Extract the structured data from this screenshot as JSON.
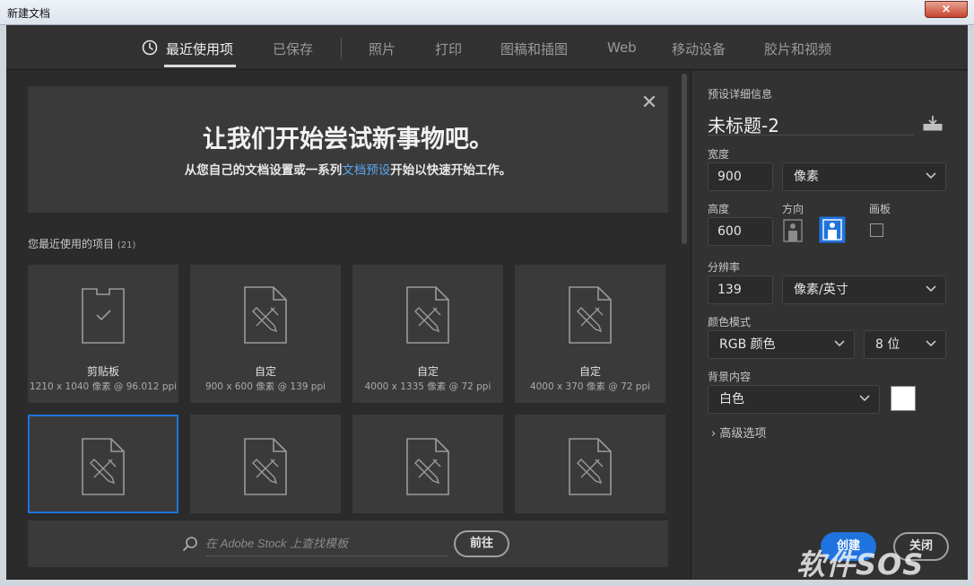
{
  "window": {
    "title": "新建文档",
    "close_glyph": "×"
  },
  "tabs": [
    {
      "label": "最近使用项",
      "active": true,
      "icon": "clock-icon"
    },
    {
      "label": "已保存"
    },
    {
      "label": "照片"
    },
    {
      "label": "打印"
    },
    {
      "label": "图稿和插图"
    },
    {
      "label": "Web"
    },
    {
      "label": "移动设备"
    },
    {
      "label": "胶片和视频"
    }
  ],
  "welcome": {
    "title": "让我们开始尝试新事物吧。",
    "sub_before": "从您自己的文档设置或一系列",
    "sub_link": "文档预设",
    "sub_after": "开始以快速开始工作。",
    "close_glyph": "✕"
  },
  "recent": {
    "label": "您最近使用的项目",
    "count": "(21)",
    "items": [
      {
        "name": "剪贴板",
        "meta": "1210 x 1040 像素 @ 96.012 ppi",
        "icon": "clipboard-icon"
      },
      {
        "name": "自定",
        "meta": "900 x 600 像素 @ 139 ppi",
        "icon": "document-custom-icon"
      },
      {
        "name": "自定",
        "meta": "4000 x 1335 像素 @ 72 ppi",
        "icon": "document-custom-icon"
      },
      {
        "name": "自定",
        "meta": "4000 x 370 像素 @ 72 ppi",
        "icon": "document-custom-icon"
      },
      {
        "name": "",
        "meta": "",
        "icon": "document-custom-icon",
        "selected": true
      },
      {
        "name": "",
        "meta": "",
        "icon": "document-custom-icon"
      },
      {
        "name": "",
        "meta": "",
        "icon": "document-custom-icon"
      },
      {
        "name": "",
        "meta": "",
        "icon": "document-custom-icon"
      }
    ]
  },
  "search": {
    "placeholder": "在 Adobe Stock 上查找模板",
    "go_label": "前往"
  },
  "preset": {
    "section_label": "预设详细信息",
    "doc_name": "未标题-2",
    "width_label": "宽度",
    "width_value": "900",
    "width_unit": "像素",
    "height_label": "高度",
    "height_value": "600",
    "orientation_label": "方向",
    "orientation": "landscape",
    "artboard_label": "画板",
    "artboard_checked": false,
    "resolution_label": "分辨率",
    "resolution_value": "139",
    "resolution_unit": "像素/英寸",
    "color_mode_label": "颜色模式",
    "color_mode": "RGB 颜色",
    "bit_depth": "8 位",
    "background_label": "背景内容",
    "background_value": "白色",
    "background_color": "#ffffff",
    "advanced_label": "高级选项"
  },
  "actions": {
    "create_label": "创建",
    "close_label": "关闭"
  },
  "watermark": {
    "text": "软件SOS"
  },
  "colors": {
    "accent": "#1f73de",
    "link": "#5aa7f0",
    "panel": "#323232",
    "bg": "#2b2b2b"
  }
}
